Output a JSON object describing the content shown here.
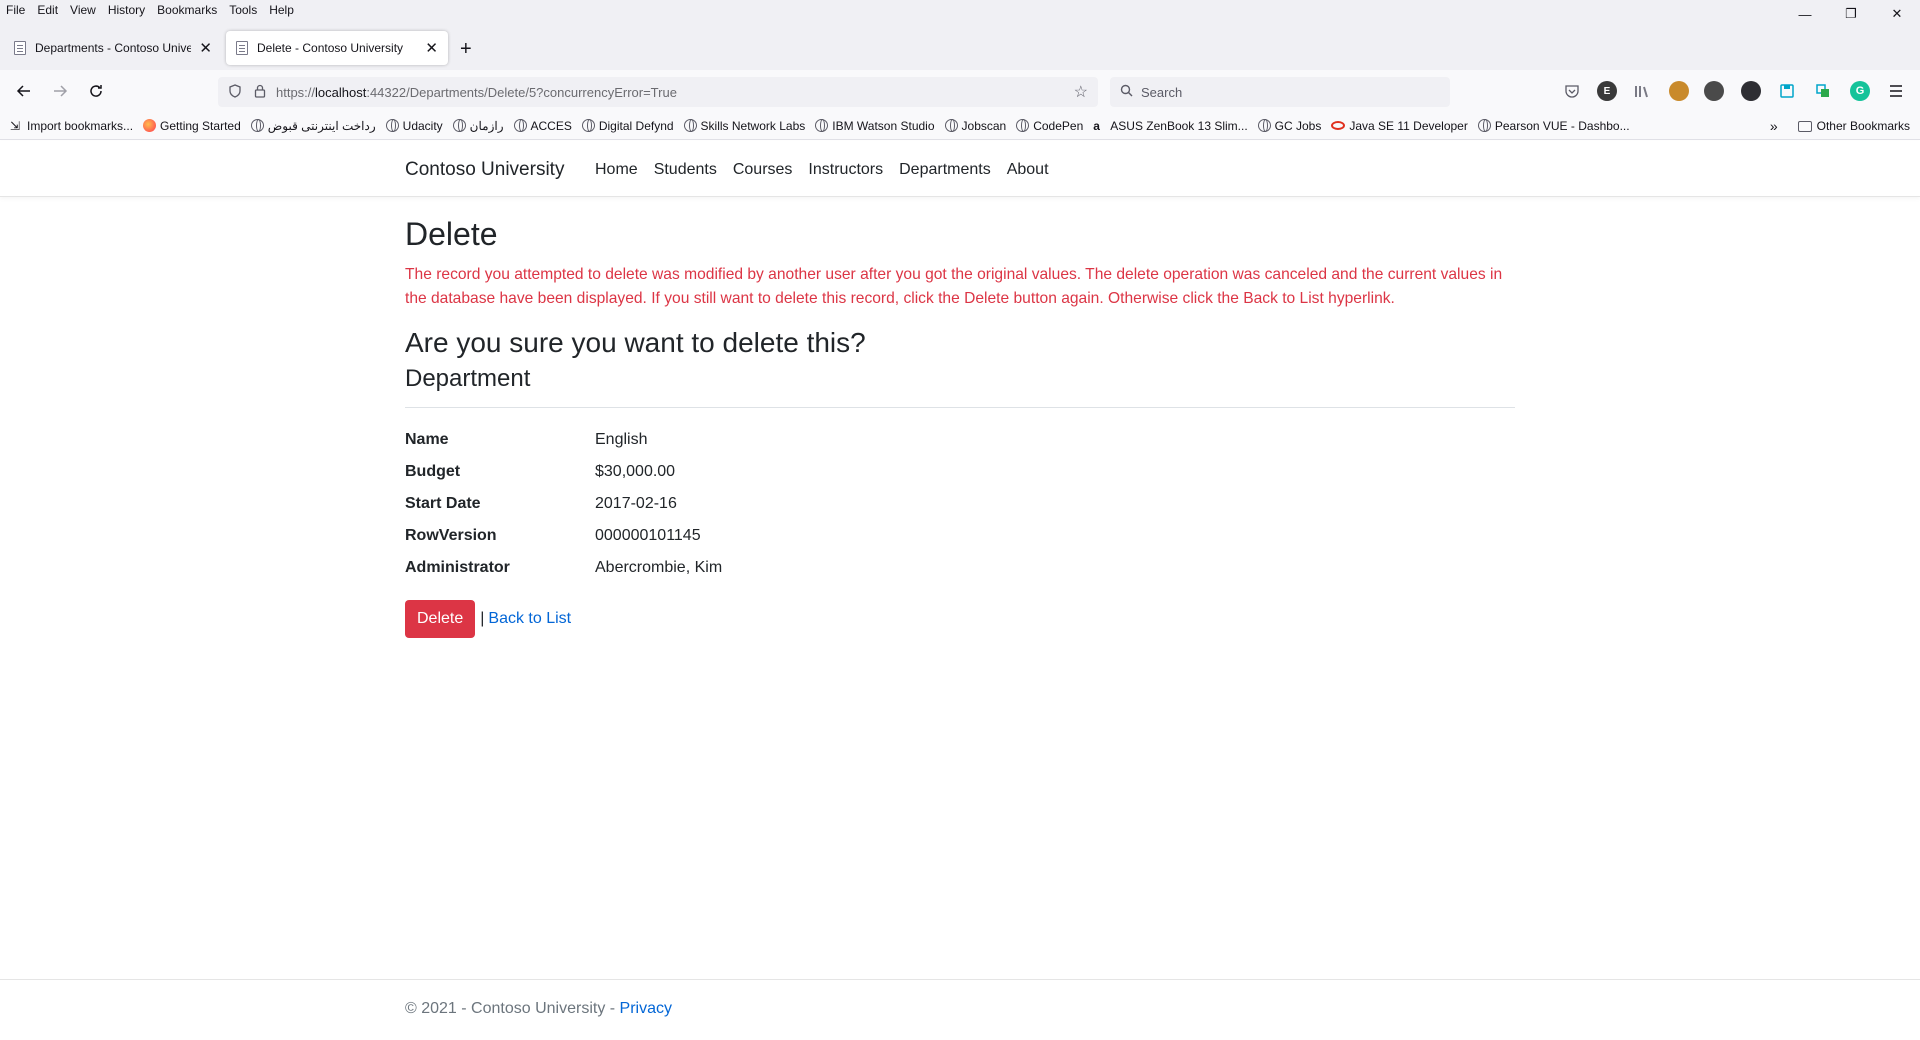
{
  "browser": {
    "menu": [
      "File",
      "Edit",
      "View",
      "History",
      "Bookmarks",
      "Tools",
      "Help"
    ],
    "window_controls": {
      "minimize": "—",
      "restore": "❐",
      "close": "✕"
    },
    "tabs": [
      {
        "title": "Departments - Contoso University",
        "close": "✕"
      },
      {
        "title": "Delete - Contoso University",
        "close": "✕"
      }
    ],
    "new_tab": "+",
    "url_scheme": "https://",
    "url_host": "localhost",
    "url_rest": ":44322/Departments/Delete/5?concurrencyError=True",
    "search_placeholder": "Search",
    "extensions": [
      "pocket-icon",
      "ext-e-icon",
      "library-icon",
      "profile-icon",
      "ext-cluster-icon",
      "ext-link-icon",
      "save-icon",
      "sync-icon",
      "grammarly-icon",
      "menu-icon"
    ],
    "bookmarks": [
      {
        "label": "Import bookmarks...",
        "icon": "import-icon"
      },
      {
        "label": "Getting Started",
        "icon": "firefox-icon"
      },
      {
        "label": "رداخت اینترنتی قبوض",
        "icon": "globe-icon"
      },
      {
        "label": "Udacity",
        "icon": "globe-icon"
      },
      {
        "label": "رازمان",
        "icon": "globe-icon"
      },
      {
        "label": "ACCES",
        "icon": "globe-icon"
      },
      {
        "label": "Digital Defynd",
        "icon": "globe-icon"
      },
      {
        "label": "Skills Network Labs",
        "icon": "globe-icon"
      },
      {
        "label": "IBM Watson Studio",
        "icon": "globe-icon"
      },
      {
        "label": "Jobscan",
        "icon": "globe-icon"
      },
      {
        "label": "CodePen",
        "icon": "globe-icon"
      },
      {
        "label": "ASUS ZenBook 13 Slim...",
        "icon": "amazon-icon"
      },
      {
        "label": "GC Jobs",
        "icon": "globe-icon"
      },
      {
        "label": "Java SE 11 Developer",
        "icon": "oracle-icon"
      },
      {
        "label": "Pearson VUE - Dashbo...",
        "icon": "globe-icon"
      }
    ],
    "other_bookmarks": "Other Bookmarks"
  },
  "site": {
    "brand": "Contoso University",
    "nav": [
      "Home",
      "Students",
      "Courses",
      "Instructors",
      "Departments",
      "About"
    ]
  },
  "page": {
    "title": "Delete",
    "error": "The record you attempted to delete was modified by another user after you got the original values. The delete operation was canceled and the current values in the database have been displayed. If you still want to delete this record, click the Delete button again. Otherwise click the Back to List hyperlink.",
    "question": "Are you sure you want to delete this?",
    "entity": "Department",
    "fields": [
      {
        "label": "Name",
        "value": "English"
      },
      {
        "label": "Budget",
        "value": "$30,000.00"
      },
      {
        "label": "Start Date",
        "value": "2017-02-16"
      },
      {
        "label": "RowVersion",
        "value": "000000101145"
      },
      {
        "label": "Administrator",
        "value": "Abercrombie, Kim"
      }
    ],
    "delete_label": "Delete",
    "separator": "|",
    "back_label": "Back to List"
  },
  "footer": {
    "text": "© 2021 - Contoso University - ",
    "privacy": "Privacy"
  },
  "colors": {
    "danger": "#dc3545",
    "link": "#0366d6"
  }
}
